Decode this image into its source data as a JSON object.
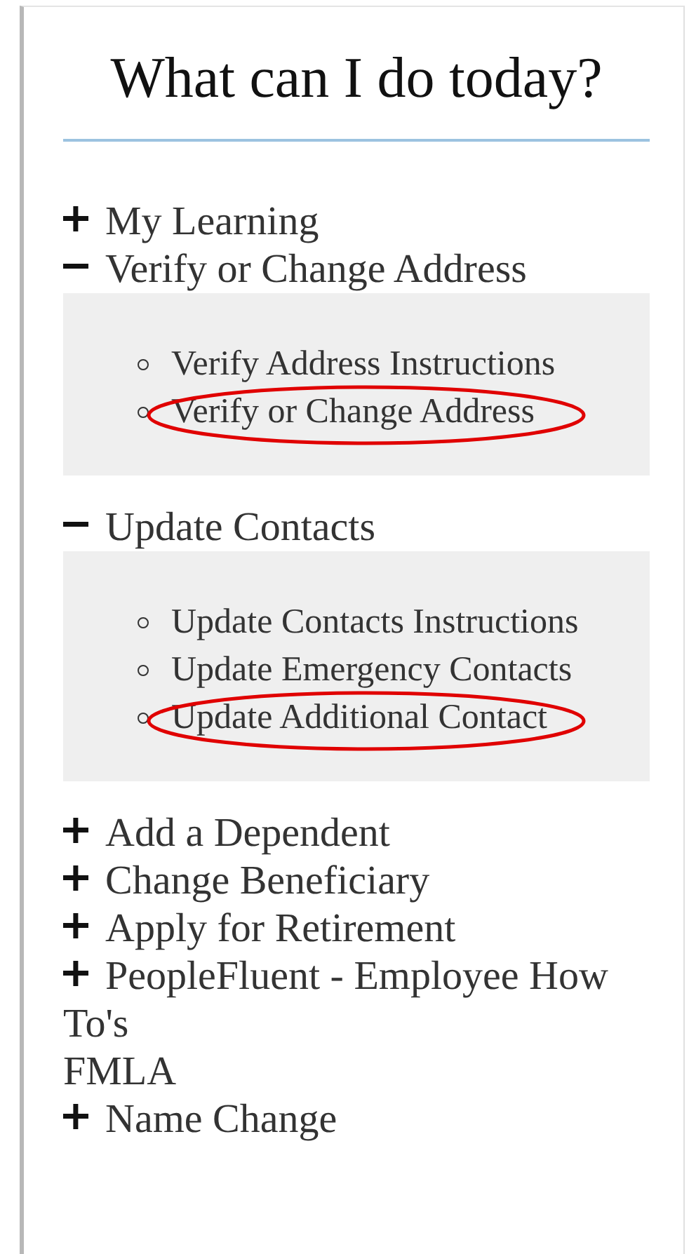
{
  "title": "What can I do today?",
  "sections": [
    {
      "kind": "expander",
      "label": "My Learning",
      "expanded": false
    },
    {
      "kind": "expander",
      "label": "Verify or Change Address",
      "expanded": true,
      "links": [
        {
          "label": "Verify Address Instructions",
          "circled": false
        },
        {
          "label": "Verify or Change Address",
          "circled": true
        }
      ]
    },
    {
      "kind": "expander",
      "label": "Update Contacts",
      "expanded": true,
      "links": [
        {
          "label": "Update Contacts Instructions",
          "circled": false
        },
        {
          "label": "Update Emergency Contacts",
          "circled": false
        },
        {
          "label": "Update Additional Contact",
          "circled": true
        }
      ]
    },
    {
      "kind": "expander",
      "label": "Add a Dependent",
      "expanded": false
    },
    {
      "kind": "expander",
      "label": "Change Beneficiary",
      "expanded": false
    },
    {
      "kind": "expander",
      "label": "Apply for Retirement",
      "expanded": false
    },
    {
      "kind": "expander",
      "label": "PeopleFluent - Employee How To's",
      "expanded": false
    },
    {
      "kind": "plain",
      "label": "FMLA"
    },
    {
      "kind": "expander",
      "label": "Name Change",
      "expanded": false
    }
  ]
}
